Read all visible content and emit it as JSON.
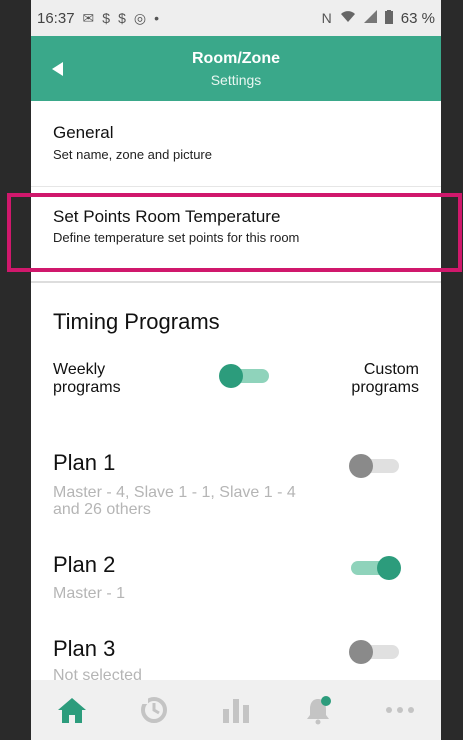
{
  "status_bar": {
    "time": "16:37",
    "battery": "63 %"
  },
  "header": {
    "title": "Room/Zone",
    "subtitle": "Settings"
  },
  "menu": [
    {
      "title": "General",
      "subtitle": "Set name, zone and picture"
    },
    {
      "title": "Set Points Room Temperature",
      "subtitle": "Define temperature set points for this room"
    }
  ],
  "timing": {
    "section_title": "Timing Programs",
    "weekly_label": "Weekly programs",
    "custom_label": "Custom programs",
    "plans": [
      {
        "name": "Plan 1",
        "subtitle": "Master - 4, Slave 1 - 1, Slave 1 - 4 and 26 others",
        "enabled": false
      },
      {
        "name": "Plan 2",
        "subtitle": "Master - 1",
        "enabled": true
      },
      {
        "name": "Plan 3",
        "subtitle": "Not selected",
        "enabled": false
      }
    ]
  },
  "colors": {
    "accent": "#3aa88a",
    "highlight": "#d0186c",
    "nav_active": "#2c9c7c",
    "nav_inactive": "#c4c4c4"
  },
  "nav": [
    "home-icon",
    "history-clock-icon",
    "statistics-icon",
    "notifications-bell-icon",
    "more-icon"
  ]
}
